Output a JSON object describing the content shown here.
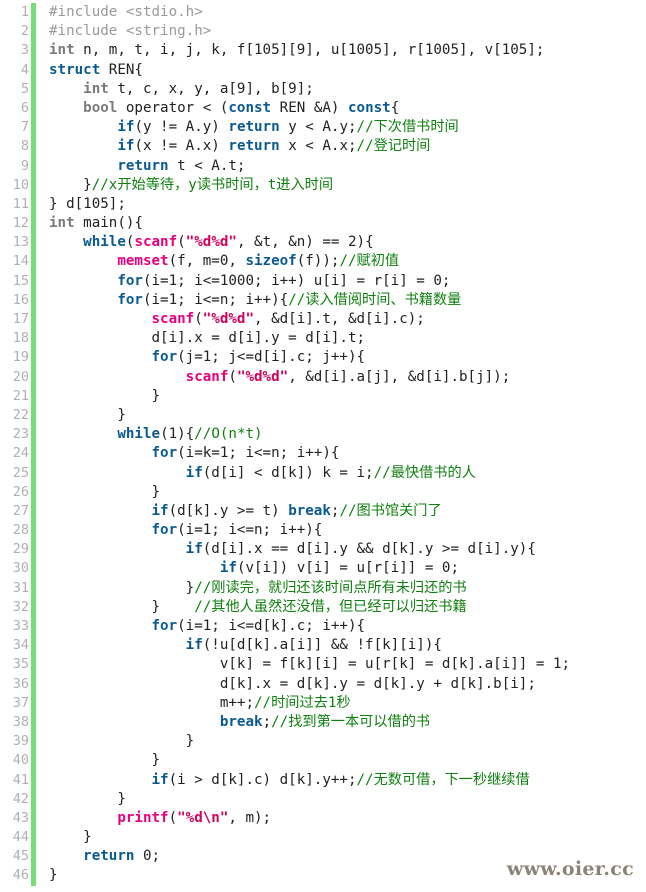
{
  "editor": {
    "language": "cpp",
    "first_line": 1,
    "last_line": 46,
    "colors": {
      "background": "#ffffff",
      "gutter_text": "#b0b0b0",
      "gutter_bar": "#77dd77",
      "plain": "#222222",
      "keyword": "#0a5a90",
      "type": "#7a7a7a",
      "function": "#e6007e",
      "string": "#d4005a",
      "comment": "#108010",
      "preprocessor": "#9a9a9a"
    }
  },
  "watermark": {
    "text": "www.oier.cc"
  },
  "lines": [
    {
      "n": "1",
      "tokens": [
        {
          "c": "pre",
          "t": "#include <stdio.h>"
        }
      ]
    },
    {
      "n": "2",
      "tokens": [
        {
          "c": "pre",
          "t": "#include <string.h>"
        }
      ]
    },
    {
      "n": "3",
      "tokens": [
        {
          "c": "type",
          "t": "int"
        },
        {
          "c": "plain",
          "t": " n, m, t, i, j, k, f[105][9], u[1005], r[1005], v[105];"
        }
      ]
    },
    {
      "n": "4",
      "tokens": [
        {
          "c": "kw",
          "t": "struct"
        },
        {
          "c": "plain",
          "t": " REN{"
        }
      ]
    },
    {
      "n": "5",
      "tokens": [
        {
          "c": "plain",
          "t": "    "
        },
        {
          "c": "type",
          "t": "int"
        },
        {
          "c": "plain",
          "t": " t, c, x, y, a[9], b[9];"
        }
      ]
    },
    {
      "n": "6",
      "tokens": [
        {
          "c": "plain",
          "t": "    "
        },
        {
          "c": "type",
          "t": "bool"
        },
        {
          "c": "plain",
          "t": " operator < ("
        },
        {
          "c": "kw",
          "t": "const"
        },
        {
          "c": "plain",
          "t": " REN &A) "
        },
        {
          "c": "kw",
          "t": "const"
        },
        {
          "c": "plain",
          "t": "{"
        }
      ]
    },
    {
      "n": "7",
      "tokens": [
        {
          "c": "plain",
          "t": "        "
        },
        {
          "c": "kw",
          "t": "if"
        },
        {
          "c": "plain",
          "t": "(y != A.y) "
        },
        {
          "c": "kw",
          "t": "return"
        },
        {
          "c": "plain",
          "t": " y < A.y;"
        },
        {
          "c": "cmt",
          "t": "//下次借书时间"
        }
      ]
    },
    {
      "n": "8",
      "tokens": [
        {
          "c": "plain",
          "t": "        "
        },
        {
          "c": "kw",
          "t": "if"
        },
        {
          "c": "plain",
          "t": "(x != A.x) "
        },
        {
          "c": "kw",
          "t": "return"
        },
        {
          "c": "plain",
          "t": " x < A.x;"
        },
        {
          "c": "cmt",
          "t": "//登记时间"
        }
      ]
    },
    {
      "n": "9",
      "tokens": [
        {
          "c": "plain",
          "t": "        "
        },
        {
          "c": "kw",
          "t": "return"
        },
        {
          "c": "plain",
          "t": " t < A.t;"
        }
      ]
    },
    {
      "n": "10",
      "tokens": [
        {
          "c": "plain",
          "t": "    }"
        },
        {
          "c": "cmt",
          "t": "//x开始等待，y读书时间，t进入时间"
        }
      ]
    },
    {
      "n": "11",
      "tokens": [
        {
          "c": "plain",
          "t": "} d[105];"
        }
      ]
    },
    {
      "n": "12",
      "tokens": [
        {
          "c": "type",
          "t": "int"
        },
        {
          "c": "plain",
          "t": " main(){"
        }
      ]
    },
    {
      "n": "13",
      "tokens": [
        {
          "c": "plain",
          "t": "    "
        },
        {
          "c": "kw",
          "t": "while"
        },
        {
          "c": "plain",
          "t": "("
        },
        {
          "c": "func",
          "t": "scanf"
        },
        {
          "c": "plain",
          "t": "("
        },
        {
          "c": "str",
          "t": "\"%d%d\""
        },
        {
          "c": "plain",
          "t": ", &t, &n) == 2){"
        }
      ]
    },
    {
      "n": "14",
      "tokens": [
        {
          "c": "plain",
          "t": "        "
        },
        {
          "c": "func",
          "t": "memset"
        },
        {
          "c": "plain",
          "t": "(f, m=0, "
        },
        {
          "c": "kw",
          "t": "sizeof"
        },
        {
          "c": "plain",
          "t": "(f));"
        },
        {
          "c": "cmt",
          "t": "//赋初值"
        }
      ]
    },
    {
      "n": "15",
      "tokens": [
        {
          "c": "plain",
          "t": "        "
        },
        {
          "c": "kw",
          "t": "for"
        },
        {
          "c": "plain",
          "t": "(i=1; i<=1000; i++) u[i] = r[i] = 0;"
        }
      ]
    },
    {
      "n": "16",
      "tokens": [
        {
          "c": "plain",
          "t": "        "
        },
        {
          "c": "kw",
          "t": "for"
        },
        {
          "c": "plain",
          "t": "(i=1; i<=n; i++){"
        },
        {
          "c": "cmt",
          "t": "//读入借阅时间、书籍数量"
        }
      ]
    },
    {
      "n": "17",
      "tokens": [
        {
          "c": "plain",
          "t": "            "
        },
        {
          "c": "func",
          "t": "scanf"
        },
        {
          "c": "plain",
          "t": "("
        },
        {
          "c": "str",
          "t": "\"%d%d\""
        },
        {
          "c": "plain",
          "t": ", &d[i].t, &d[i].c);"
        }
      ]
    },
    {
      "n": "18",
      "tokens": [
        {
          "c": "plain",
          "t": "            d[i].x = d[i].y = d[i].t;"
        }
      ]
    },
    {
      "n": "19",
      "tokens": [
        {
          "c": "plain",
          "t": "            "
        },
        {
          "c": "kw",
          "t": "for"
        },
        {
          "c": "plain",
          "t": "(j=1; j<=d[i].c; j++){"
        }
      ]
    },
    {
      "n": "20",
      "tokens": [
        {
          "c": "plain",
          "t": "                "
        },
        {
          "c": "func",
          "t": "scanf"
        },
        {
          "c": "plain",
          "t": "("
        },
        {
          "c": "str",
          "t": "\"%d%d\""
        },
        {
          "c": "plain",
          "t": ", &d[i].a[j], &d[i].b[j]);"
        }
      ]
    },
    {
      "n": "21",
      "tokens": [
        {
          "c": "plain",
          "t": "            }"
        }
      ]
    },
    {
      "n": "22",
      "tokens": [
        {
          "c": "plain",
          "t": "        }"
        }
      ]
    },
    {
      "n": "23",
      "tokens": [
        {
          "c": "plain",
          "t": "        "
        },
        {
          "c": "kw",
          "t": "while"
        },
        {
          "c": "plain",
          "t": "(1){"
        },
        {
          "c": "cmt",
          "t": "//O(n*t)"
        }
      ]
    },
    {
      "n": "24",
      "tokens": [
        {
          "c": "plain",
          "t": "            "
        },
        {
          "c": "kw",
          "t": "for"
        },
        {
          "c": "plain",
          "t": "(i=k=1; i<=n; i++){"
        }
      ]
    },
    {
      "n": "25",
      "tokens": [
        {
          "c": "plain",
          "t": "                "
        },
        {
          "c": "kw",
          "t": "if"
        },
        {
          "c": "plain",
          "t": "(d[i] < d[k]) k = i;"
        },
        {
          "c": "cmt",
          "t": "//最快借书的人"
        }
      ]
    },
    {
      "n": "26",
      "tokens": [
        {
          "c": "plain",
          "t": "            }"
        }
      ]
    },
    {
      "n": "27",
      "tokens": [
        {
          "c": "plain",
          "t": "            "
        },
        {
          "c": "kw",
          "t": "if"
        },
        {
          "c": "plain",
          "t": "(d[k].y >= t) "
        },
        {
          "c": "kw",
          "t": "break"
        },
        {
          "c": "plain",
          "t": ";"
        },
        {
          "c": "cmt",
          "t": "//图书馆关门了"
        }
      ]
    },
    {
      "n": "28",
      "tokens": [
        {
          "c": "plain",
          "t": "            "
        },
        {
          "c": "kw",
          "t": "for"
        },
        {
          "c": "plain",
          "t": "(i=1; i<=n; i++){"
        }
      ]
    },
    {
      "n": "29",
      "tokens": [
        {
          "c": "plain",
          "t": "                "
        },
        {
          "c": "kw",
          "t": "if"
        },
        {
          "c": "plain",
          "t": "(d[i].x == d[i].y && d[k].y >= d[i].y){"
        }
      ]
    },
    {
      "n": "30",
      "tokens": [
        {
          "c": "plain",
          "t": "                    "
        },
        {
          "c": "kw",
          "t": "if"
        },
        {
          "c": "plain",
          "t": "(v[i]) v[i] = u[r[i]] = 0;"
        }
      ]
    },
    {
      "n": "31",
      "tokens": [
        {
          "c": "plain",
          "t": "                }"
        },
        {
          "c": "cmt",
          "t": "//刚读完，就归还该时间点所有未归还的书"
        }
      ]
    },
    {
      "n": "32",
      "tokens": [
        {
          "c": "plain",
          "t": "            }    "
        },
        {
          "c": "cmt",
          "t": "//其他人虽然还没借，但已经可以归还书籍"
        }
      ]
    },
    {
      "n": "33",
      "tokens": [
        {
          "c": "plain",
          "t": "            "
        },
        {
          "c": "kw",
          "t": "for"
        },
        {
          "c": "plain",
          "t": "(i=1; i<=d[k].c; i++){"
        }
      ]
    },
    {
      "n": "34",
      "tokens": [
        {
          "c": "plain",
          "t": "                "
        },
        {
          "c": "kw",
          "t": "if"
        },
        {
          "c": "plain",
          "t": "(!u[d[k].a[i]] && !f[k][i]){"
        }
      ]
    },
    {
      "n": "35",
      "tokens": [
        {
          "c": "plain",
          "t": "                    v[k] = f[k][i] = u[r[k] = d[k].a[i]] = 1;"
        }
      ]
    },
    {
      "n": "36",
      "tokens": [
        {
          "c": "plain",
          "t": "                    d[k].x = d[k].y = d[k].y + d[k].b[i];"
        }
      ]
    },
    {
      "n": "37",
      "tokens": [
        {
          "c": "plain",
          "t": "                    m++;"
        },
        {
          "c": "cmt",
          "t": "//时间过去1秒"
        }
      ]
    },
    {
      "n": "38",
      "tokens": [
        {
          "c": "plain",
          "t": "                    "
        },
        {
          "c": "kw",
          "t": "break"
        },
        {
          "c": "plain",
          "t": ";"
        },
        {
          "c": "cmt",
          "t": "//找到第一本可以借的书"
        }
      ]
    },
    {
      "n": "39",
      "tokens": [
        {
          "c": "plain",
          "t": "                }"
        }
      ]
    },
    {
      "n": "40",
      "tokens": [
        {
          "c": "plain",
          "t": "            }"
        }
      ]
    },
    {
      "n": "41",
      "tokens": [
        {
          "c": "plain",
          "t": "            "
        },
        {
          "c": "kw",
          "t": "if"
        },
        {
          "c": "plain",
          "t": "(i > d[k].c) d[k].y++;"
        },
        {
          "c": "cmt",
          "t": "//无数可借，下一秒继续借"
        }
      ]
    },
    {
      "n": "42",
      "tokens": [
        {
          "c": "plain",
          "t": "        }"
        }
      ]
    },
    {
      "n": "43",
      "tokens": [
        {
          "c": "plain",
          "t": "        "
        },
        {
          "c": "func",
          "t": "printf"
        },
        {
          "c": "plain",
          "t": "("
        },
        {
          "c": "str",
          "t": "\"%d\\n\""
        },
        {
          "c": "plain",
          "t": ", m);"
        }
      ]
    },
    {
      "n": "44",
      "tokens": [
        {
          "c": "plain",
          "t": "    }"
        }
      ]
    },
    {
      "n": "45",
      "tokens": [
        {
          "c": "plain",
          "t": "    "
        },
        {
          "c": "kw",
          "t": "return"
        },
        {
          "c": "plain",
          "t": " 0;"
        }
      ]
    },
    {
      "n": "46",
      "tokens": [
        {
          "c": "plain",
          "t": "}"
        }
      ]
    }
  ]
}
